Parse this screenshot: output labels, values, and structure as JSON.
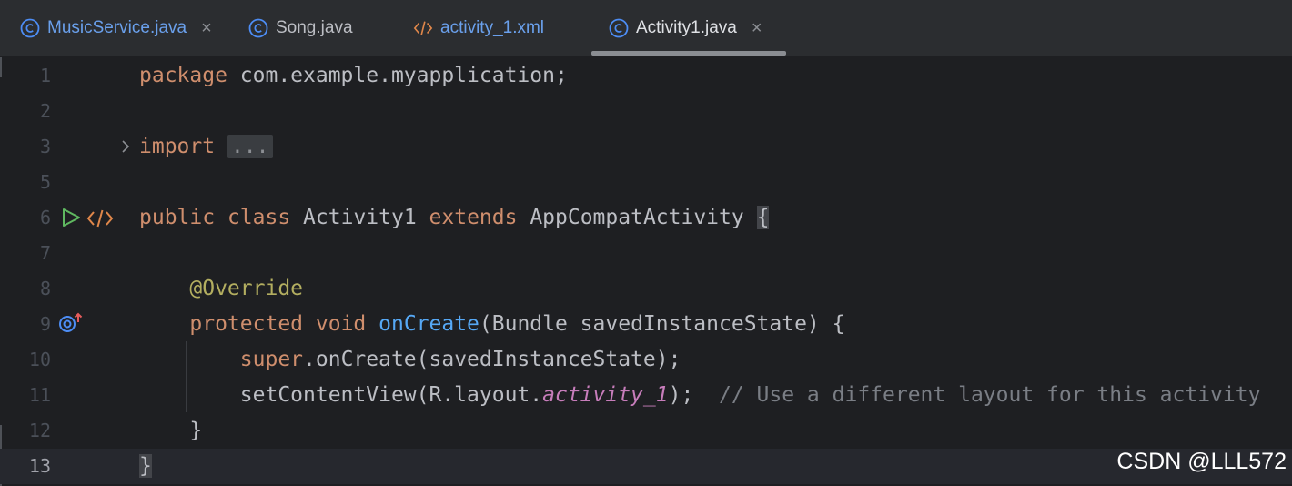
{
  "tabs": [
    {
      "label": "MusicService.java",
      "icon": "java-class-icon",
      "closable": true,
      "active": false
    },
    {
      "label": "Song.java",
      "icon": "java-class-icon",
      "closable": false,
      "active": false
    },
    {
      "label": "activity_1.xml",
      "icon": "xml-icon",
      "closable": false,
      "active": false
    },
    {
      "label": "Activity1.java",
      "icon": "java-class-icon",
      "closable": true,
      "active": true
    }
  ],
  "close_glyph": "×",
  "editor": {
    "line_numbers": [
      "1",
      "2",
      "3",
      "5",
      "6",
      "7",
      "8",
      "9",
      "10",
      "11",
      "12",
      "13"
    ],
    "current_line": "13",
    "code": {
      "l1_kw": "package",
      "l1_rest": " com.example.myapplication;",
      "l3_kw": "import",
      "l3_fold": "...",
      "l6_kw1": "public",
      "l6_kw2": "class",
      "l6_name": " Activity1 ",
      "l6_kw3": "extends",
      "l6_super": " AppCompatActivity ",
      "l6_brace": "{",
      "l8_ann": "@Override",
      "l9_kw1": "protected",
      "l9_kw2": "void",
      "l9_fn": "onCreate",
      "l9_rest": "(Bundle savedInstanceState) {",
      "l10_kw": "super",
      "l10_rest": ".onCreate(savedInstanceState);",
      "l11_pre": "setContentView(R.layout.",
      "l11_field": "activity_1",
      "l11_post": ");  ",
      "l11_comment": "// Use a different layout for this activity",
      "l12": "}",
      "l13": "}"
    }
  },
  "watermark": "CSDN @LLL572",
  "colors": {
    "keyword": "#cf8e6d",
    "annotation": "#b3ae60",
    "function": "#56a8f5",
    "field": "#c77dbb",
    "comment": "#7a7e85",
    "java_icon": "#4d8df5",
    "xml_icon": "#e0874a",
    "run_icon": "#5fb860"
  }
}
